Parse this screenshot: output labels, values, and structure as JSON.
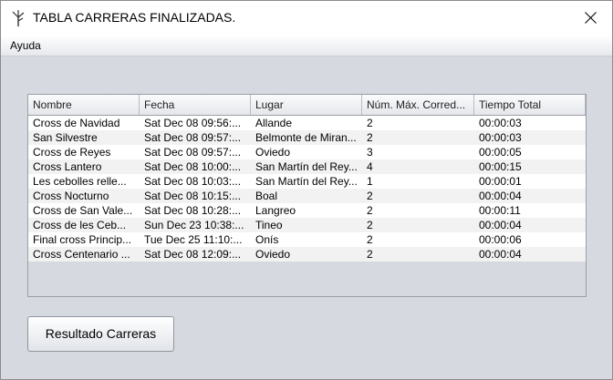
{
  "window": {
    "title": "TABLA CARRERAS FINALIZADAS."
  },
  "menubar": {
    "items": [
      {
        "label": "Ayuda"
      }
    ]
  },
  "table": {
    "columns": [
      "Nombre",
      "Fecha",
      "Lugar",
      "Núm. Máx. Corred...",
      "Tiempo Total"
    ],
    "rows": [
      [
        "Cross de Navidad",
        "Sat Dec 08 09:56:...",
        "Allande",
        "2",
        "00:00:03"
      ],
      [
        "San Silvestre",
        "Sat Dec 08 09:57:...",
        "Belmonte de Miran...",
        "2",
        "00:00:03"
      ],
      [
        "Cross de Reyes",
        "Sat Dec 08 09:57:...",
        "Oviedo",
        "3",
        "00:00:05"
      ],
      [
        "Cross Lantero",
        "Sat Dec 08 10:00:...",
        "San Martín del Rey...",
        "4",
        "00:00:15"
      ],
      [
        "Les cebolles relle...",
        "Sat Dec 08 10:03:...",
        "San Martín del Rey...",
        "1",
        "00:00:01"
      ],
      [
        "Cross Nocturno",
        "Sat Dec 08 10:15:...",
        "Boal",
        "2",
        "00:00:04"
      ],
      [
        "Cross de San Vale...",
        "Sat Dec 08 10:28:...",
        "Langreo",
        "2",
        "00:00:11"
      ],
      [
        "Cross de les Ceb...",
        "Sun Dec 23 10:38:...",
        "Tineo",
        "2",
        "00:00:04"
      ],
      [
        "Final cross Princip...",
        "Tue Dec 25 11:10:...",
        "Onís",
        "2",
        "00:00:06"
      ],
      [
        "Cross Centenario ...",
        "Sat Dec 08 12:09:...",
        "Oviedo",
        "2",
        "00:00:04"
      ]
    ]
  },
  "actions": {
    "resultado_label": "Resultado Carreras"
  },
  "icons": {
    "app": "java-app-icon",
    "close": "close-icon"
  }
}
